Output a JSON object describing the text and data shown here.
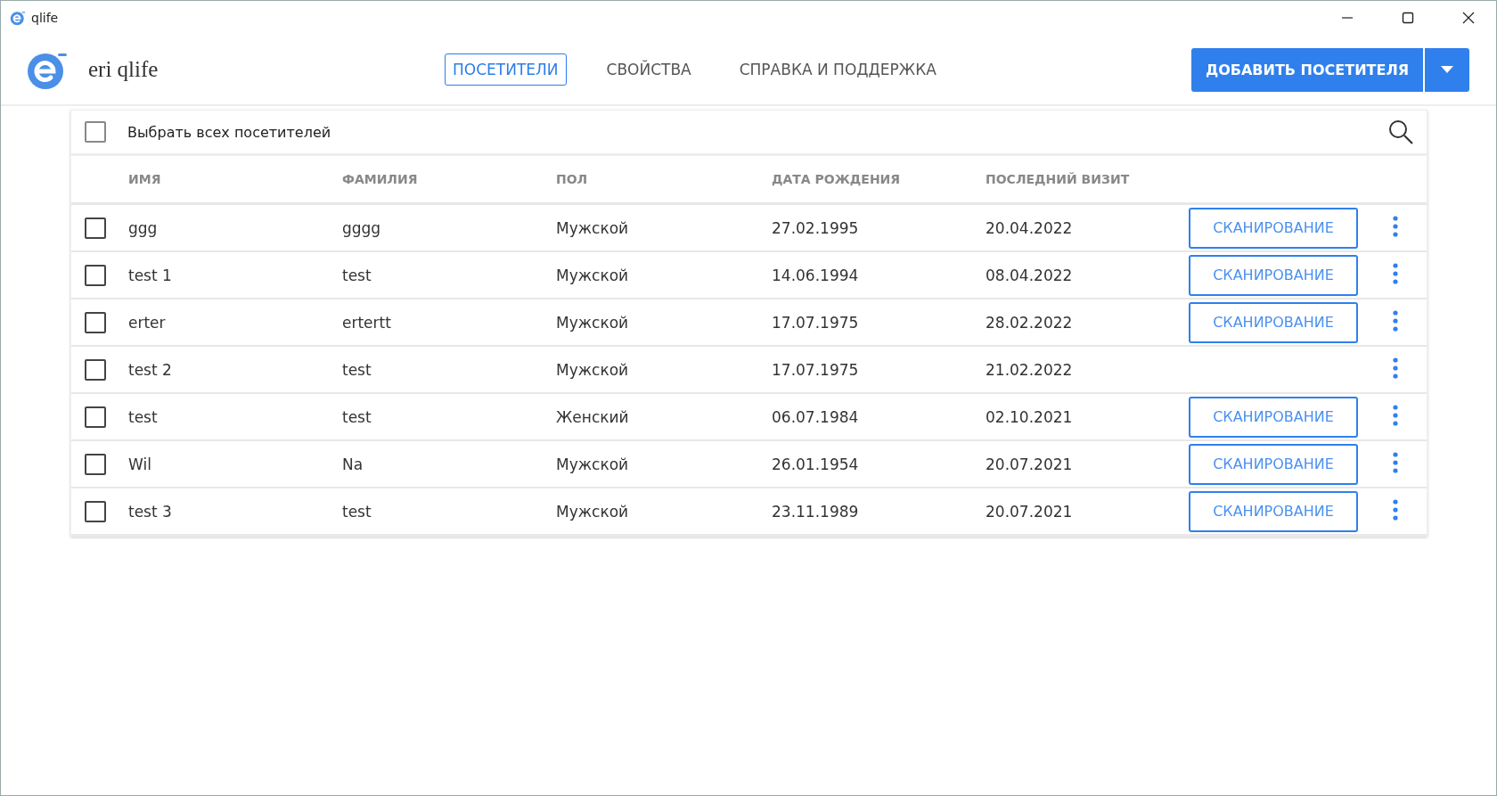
{
  "window": {
    "title": "qlife"
  },
  "app": {
    "name": "eri qlife"
  },
  "tabs": [
    {
      "label": "ПОСЕТИТЕЛИ",
      "selected": true
    },
    {
      "label": "СВОЙСТВА",
      "selected": false
    },
    {
      "label": "СПРАВКА И ПОДДЕРЖКА",
      "selected": false
    }
  ],
  "add_button": {
    "label": "ДОБАВИТЬ ПОСЕТИТЕЛЯ"
  },
  "select_all": {
    "label": "Выбрать всех посетителей",
    "checked": false
  },
  "table": {
    "columns": [
      "ИМЯ",
      "ФАМИЛИЯ",
      "ПОЛ",
      "ДАТА РОЖДЕНИЯ",
      "ПОСЛЕДНИЙ ВИЗИТ"
    ],
    "rows": [
      {
        "checked": false,
        "cells": [
          "ggg",
          "gggg",
          "Мужской",
          "27.02.1995",
          "20.04.2022"
        ],
        "scan": "СКАНИРОВАНИЕ"
      },
      {
        "checked": false,
        "cells": [
          "test 1",
          "test",
          "Мужской",
          "14.06.1994",
          "08.04.2022"
        ],
        "scan": "СКАНИРОВАНИЕ"
      },
      {
        "checked": false,
        "cells": [
          "erter",
          "ertertt",
          "Мужской",
          "17.07.1975",
          "28.02.2022"
        ],
        "scan": "СКАНИРОВАНИЕ"
      },
      {
        "checked": false,
        "cells": [
          "test 2",
          "test",
          "Мужской",
          "17.07.1975",
          "21.02.2022"
        ]
      },
      {
        "checked": false,
        "cells": [
          "test",
          "test",
          "Женский",
          "06.07.1984",
          "02.10.2021"
        ],
        "scan": "СКАНИРОВАНИЕ"
      },
      {
        "checked": false,
        "cells": [
          "Wil",
          "Na",
          "Мужской",
          "26.01.1954",
          "20.07.2021"
        ],
        "scan": "СКАНИРОВАНИЕ"
      },
      {
        "checked": false,
        "cells": [
          "test 3",
          "test",
          "Мужской",
          "23.11.1989",
          "20.07.2021"
        ],
        "scan": "СКАНИРОВАНИЕ"
      }
    ]
  }
}
